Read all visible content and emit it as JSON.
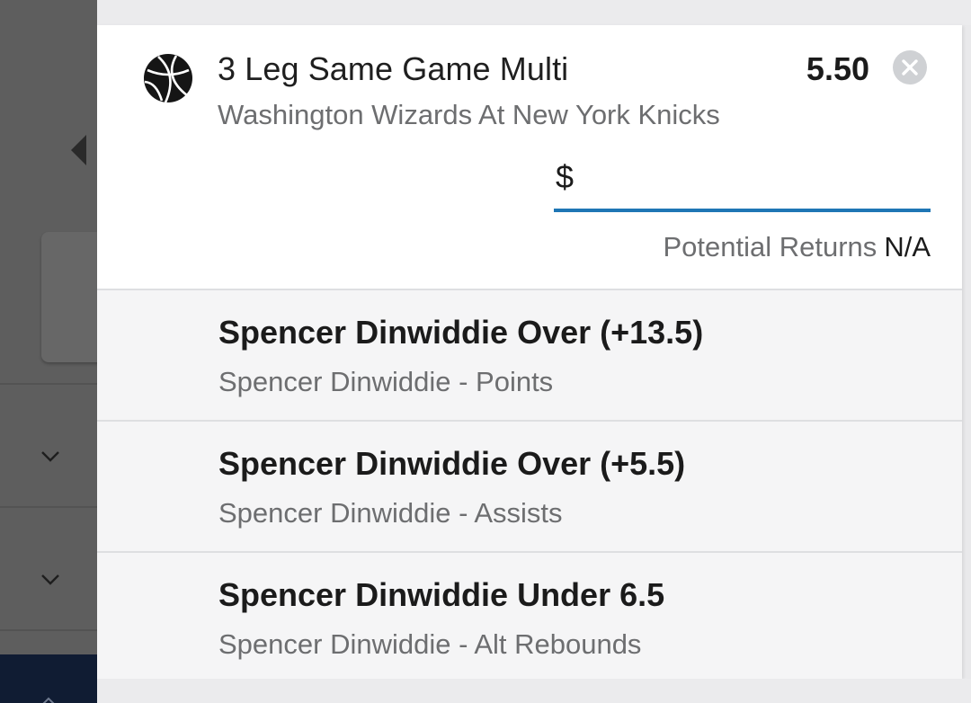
{
  "betslip": {
    "sport_icon": "basketball-icon",
    "title": "3 Leg Same Game Multi",
    "odds": "5.50",
    "remove_icon": "close-icon",
    "event": "Washington Wizards At New York Knicks",
    "stake": {
      "currency": "$",
      "value": "",
      "placeholder": ""
    },
    "returns": {
      "label": "Potential Returns",
      "value": "N/A"
    },
    "legs": [
      {
        "selection": "Spencer Dinwiddie Over (+13.5)",
        "market": "Spencer Dinwiddie - Points"
      },
      {
        "selection": "Spencer Dinwiddie Over (+5.5)",
        "market": "Spencer Dinwiddie - Assists"
      },
      {
        "selection": "Spencer Dinwiddie Under 6.5",
        "market": "Spencer Dinwiddie - Alt Rebounds"
      }
    ]
  },
  "colors": {
    "accent": "#1f76b5",
    "overlay": "#5e5e5e",
    "navy": "#101c33",
    "secondary_text": "#6d6e70"
  },
  "background_icons": [
    "chevron-left-icon",
    "chevron-down-icon",
    "chevron-down-icon"
  ]
}
